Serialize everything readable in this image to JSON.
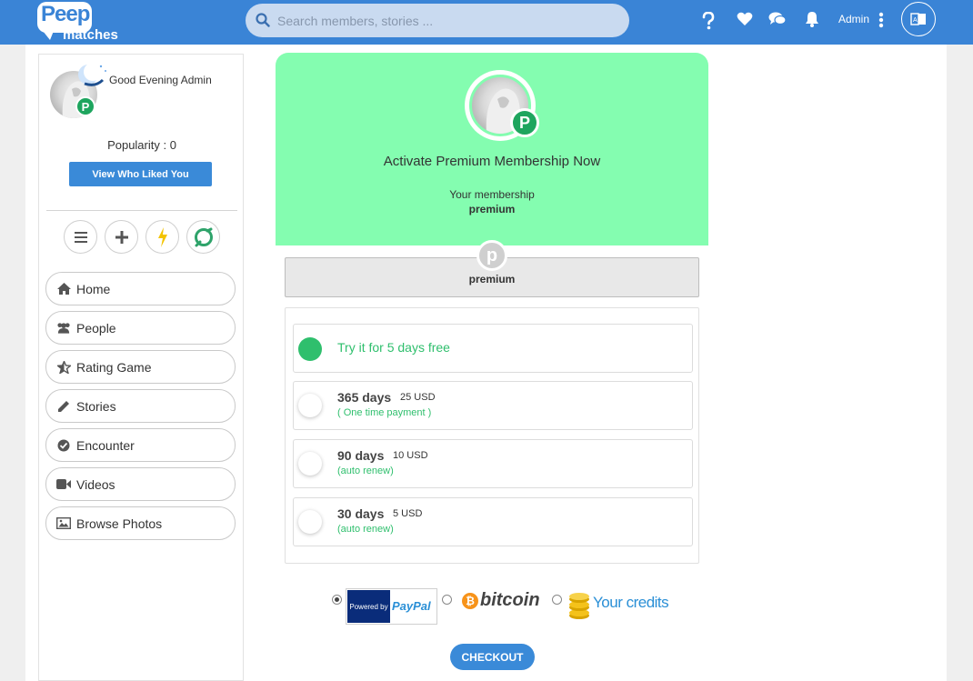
{
  "brand": {
    "name_top": "eep",
    "name_bottom": "matches",
    "color": "#3a84d6"
  },
  "search": {
    "placeholder": "Search members, stories ..."
  },
  "header": {
    "user_label": "Admin"
  },
  "sidebar": {
    "greeting": "Good Evening Admin",
    "badge": "P",
    "popularity": "Popularity : 0",
    "liked_button": "View Who Liked You",
    "quick_actions": [
      "menu-icon",
      "plus-icon",
      "lightning-icon",
      "chat-ring-icon"
    ],
    "menu": [
      {
        "label": "Home",
        "icon": "home-icon"
      },
      {
        "label": "People",
        "icon": "people-icon"
      },
      {
        "label": "Rating Game",
        "icon": "star-icon"
      },
      {
        "label": "Stories",
        "icon": "pencil-icon"
      },
      {
        "label": "Encounter",
        "icon": "check-circle-icon"
      },
      {
        "label": "Videos",
        "icon": "video-icon"
      },
      {
        "label": "Browse Photos",
        "icon": "photo-icon"
      }
    ]
  },
  "membership": {
    "title": "Activate Premium Membership Now",
    "your_membership": "Your membership",
    "membership_value": "premium",
    "badge": "P",
    "plan_letter": "p",
    "plan_name": "premium",
    "accent": "#84fdb0",
    "options": [
      {
        "free": "Try it for 5 days free",
        "selected": true
      },
      {
        "days": "365 days",
        "price": "25 USD",
        "note": "( One time payment )",
        "selected": false
      },
      {
        "days": "90 days",
        "price": "10 USD",
        "note": "(auto renew)",
        "selected": false
      },
      {
        "days": "30 days",
        "price": "5 USD",
        "note": "(auto renew)",
        "selected": false
      }
    ]
  },
  "payment": {
    "paypal_powered": "Powered by",
    "paypal_pay": "Pay",
    "paypal_pal": "Pal",
    "bitcoin_symbol": "₿",
    "bitcoin": "bitcoin",
    "credits": "Your credits",
    "checkout": "CHECKOUT"
  }
}
